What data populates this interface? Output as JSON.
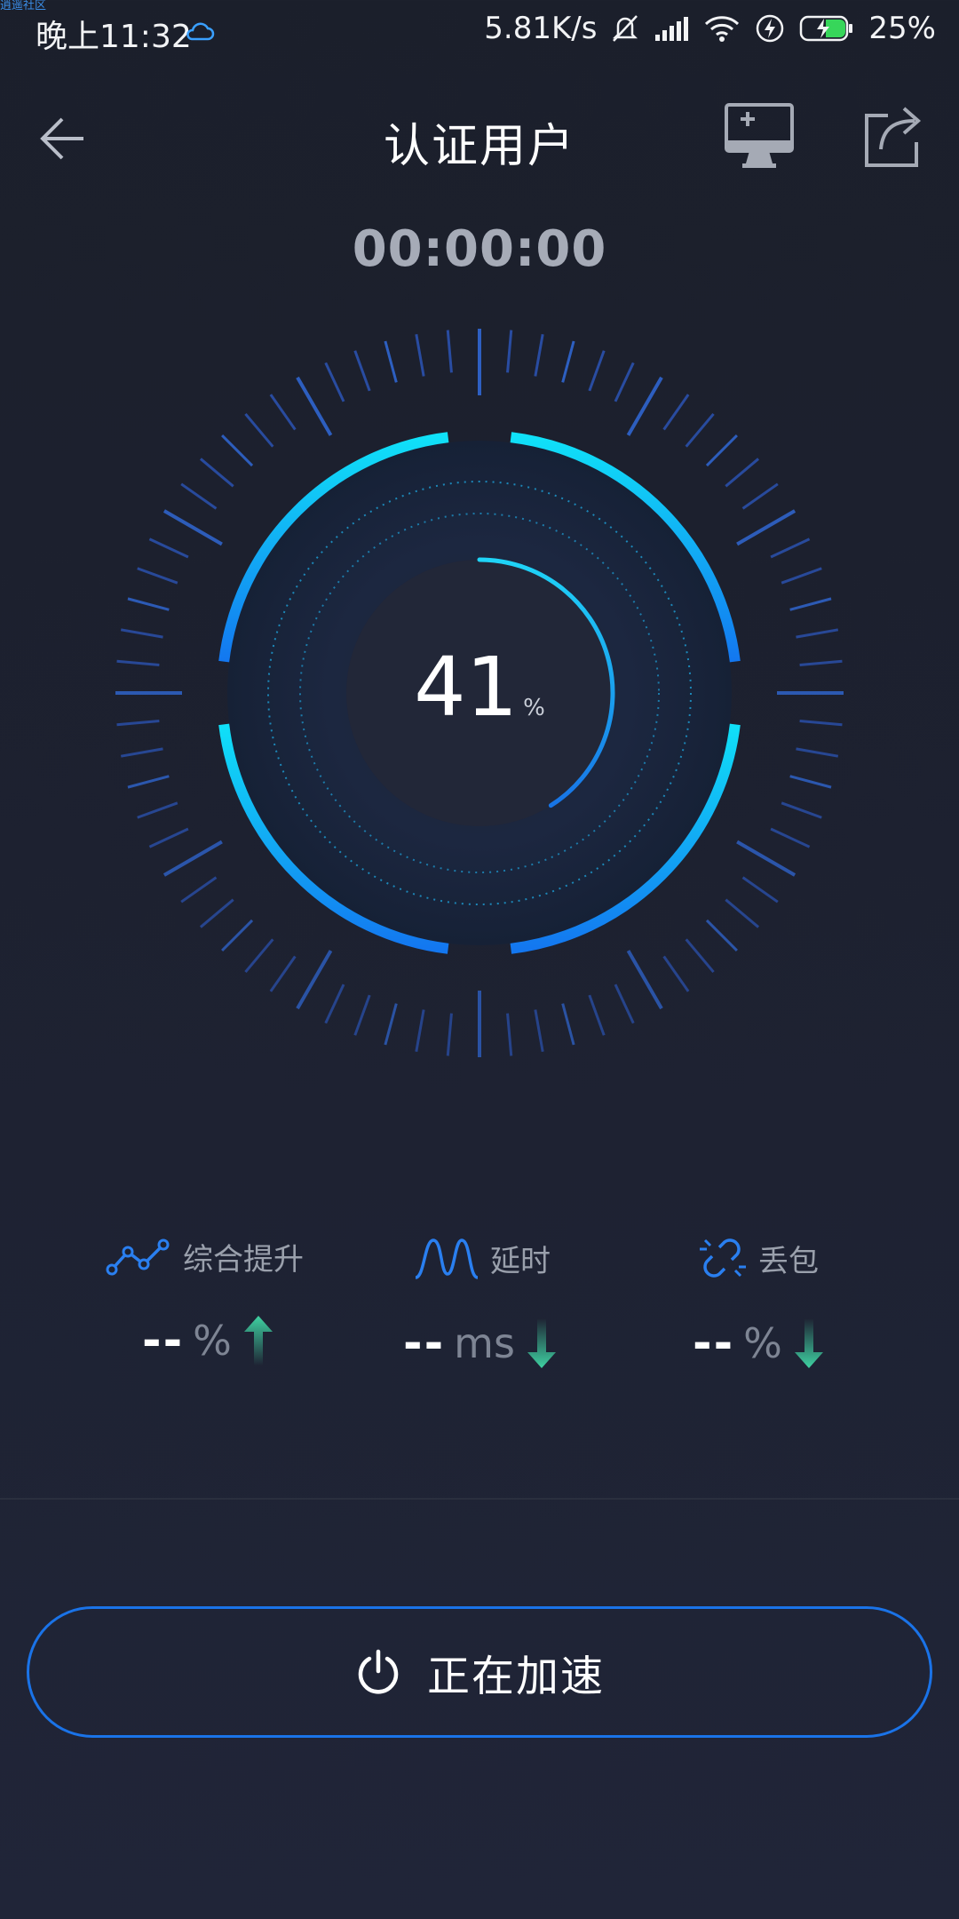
{
  "watermark": "逍遥社区",
  "status_bar": {
    "time": "晚上11:32",
    "net_speed": "5.81K/s",
    "battery": "25%"
  },
  "header": {
    "title": "认证用户"
  },
  "timer": "00:00:00",
  "progress": {
    "value": "41",
    "unit": "%",
    "fraction": 0.41
  },
  "stats": {
    "boost": {
      "label": "综合提升",
      "value": "--",
      "unit": "%"
    },
    "latency": {
      "label": "延时",
      "value": "--",
      "unit": "ms"
    },
    "loss": {
      "label": "丢包",
      "value": "--",
      "unit": "%"
    }
  },
  "action_button": {
    "label": "正在加速"
  },
  "colors": {
    "accent_blue": "#1a73e8",
    "ring_cyan": "#14d6f5",
    "arrow_green": "#3fd2a2",
    "background": "#1d2130"
  }
}
